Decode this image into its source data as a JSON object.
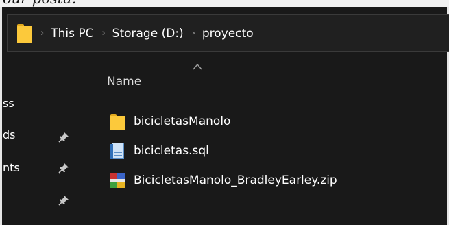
{
  "top_caption": "our posta.",
  "breadcrumb": {
    "items": [
      {
        "label": "This PC"
      },
      {
        "label": "Storage (D:)"
      },
      {
        "label": "proyecto"
      }
    ],
    "separator": "›"
  },
  "nav_pane": {
    "items": [
      {
        "label": "ss",
        "pinned": false
      },
      {
        "label": "ds",
        "pinned": true
      },
      {
        "label": "nts",
        "pinned": true
      },
      {
        "label": "",
        "pinned": true
      }
    ]
  },
  "content": {
    "column_name": "Name",
    "sort_direction": "ascending",
    "files": [
      {
        "name": "bicicletasManolo",
        "icon": "folder-icon"
      },
      {
        "name": "bicicletas.sql",
        "icon": "sql-file-icon"
      },
      {
        "name": "BicicletasManolo_BradleyEarley.zip",
        "icon": "winrar-archive-icon"
      }
    ]
  },
  "colors": {
    "window_bg": "#191919",
    "address_bar_bg": "#202020",
    "folder_yellow": "#fcc93b"
  }
}
